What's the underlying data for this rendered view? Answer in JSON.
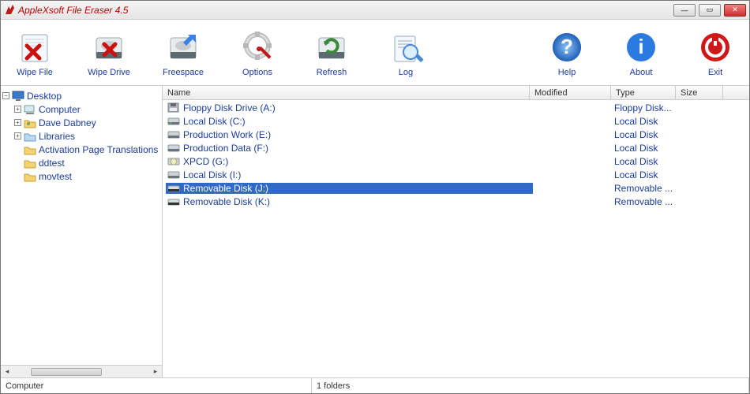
{
  "window": {
    "title": "AppleXsoft File Eraser 4.5"
  },
  "winbuttons": {
    "min": "—",
    "max": "▭",
    "close": "✕"
  },
  "toolbar": [
    {
      "id": "wipe-file",
      "label": "Wipe File"
    },
    {
      "id": "wipe-drive",
      "label": "Wipe Drive"
    },
    {
      "id": "freespace",
      "label": "Freespace"
    },
    {
      "id": "options",
      "label": "Options"
    },
    {
      "id": "refresh",
      "label": "Refresh"
    },
    {
      "id": "log",
      "label": "Log"
    },
    {
      "id": "help",
      "label": "Help"
    },
    {
      "id": "about",
      "label": "About"
    },
    {
      "id": "exit",
      "label": "Exit"
    }
  ],
  "tree": {
    "root": {
      "label": "Desktop",
      "expanded": true
    },
    "children": [
      {
        "label": "Computer",
        "icon": "computer",
        "expandable": true
      },
      {
        "label": "Dave Dabney",
        "icon": "user-folder",
        "expandable": true
      },
      {
        "label": "Libraries",
        "icon": "libraries",
        "expandable": true
      },
      {
        "label": "Activation Page Translations",
        "icon": "folder",
        "expandable": false
      },
      {
        "label": "ddtest",
        "icon": "folder",
        "expandable": false
      },
      {
        "label": "movtest",
        "icon": "folder",
        "expandable": false
      }
    ]
  },
  "columns": {
    "name": "Name",
    "modified": "Modified",
    "type": "Type",
    "size": "Size"
  },
  "rows": [
    {
      "name": "Floppy Disk Drive (A:)",
      "type": "Floppy Disk...",
      "icon": "floppy",
      "selected": false
    },
    {
      "name": "Local Disk (C:)",
      "type": "Local Disk",
      "icon": "hdd",
      "selected": false
    },
    {
      "name": "Production Work (E:)",
      "type": "Local Disk",
      "icon": "hdd-ext",
      "selected": false
    },
    {
      "name": "Production Data (F:)",
      "type": "Local Disk",
      "icon": "hdd-ext",
      "selected": false
    },
    {
      "name": "XPCD (G:)",
      "type": "Local Disk",
      "icon": "cd",
      "selected": false
    },
    {
      "name": "Local Disk (I:)",
      "type": "Local Disk",
      "icon": "hdd-ext",
      "selected": false
    },
    {
      "name": "Removable Disk (J:)",
      "type": "Removable ...",
      "icon": "removable",
      "selected": true
    },
    {
      "name": "Removable Disk (K:)",
      "type": "Removable ...",
      "icon": "removable",
      "selected": false
    }
  ],
  "status": {
    "left": "Computer",
    "right": "1 folders"
  }
}
